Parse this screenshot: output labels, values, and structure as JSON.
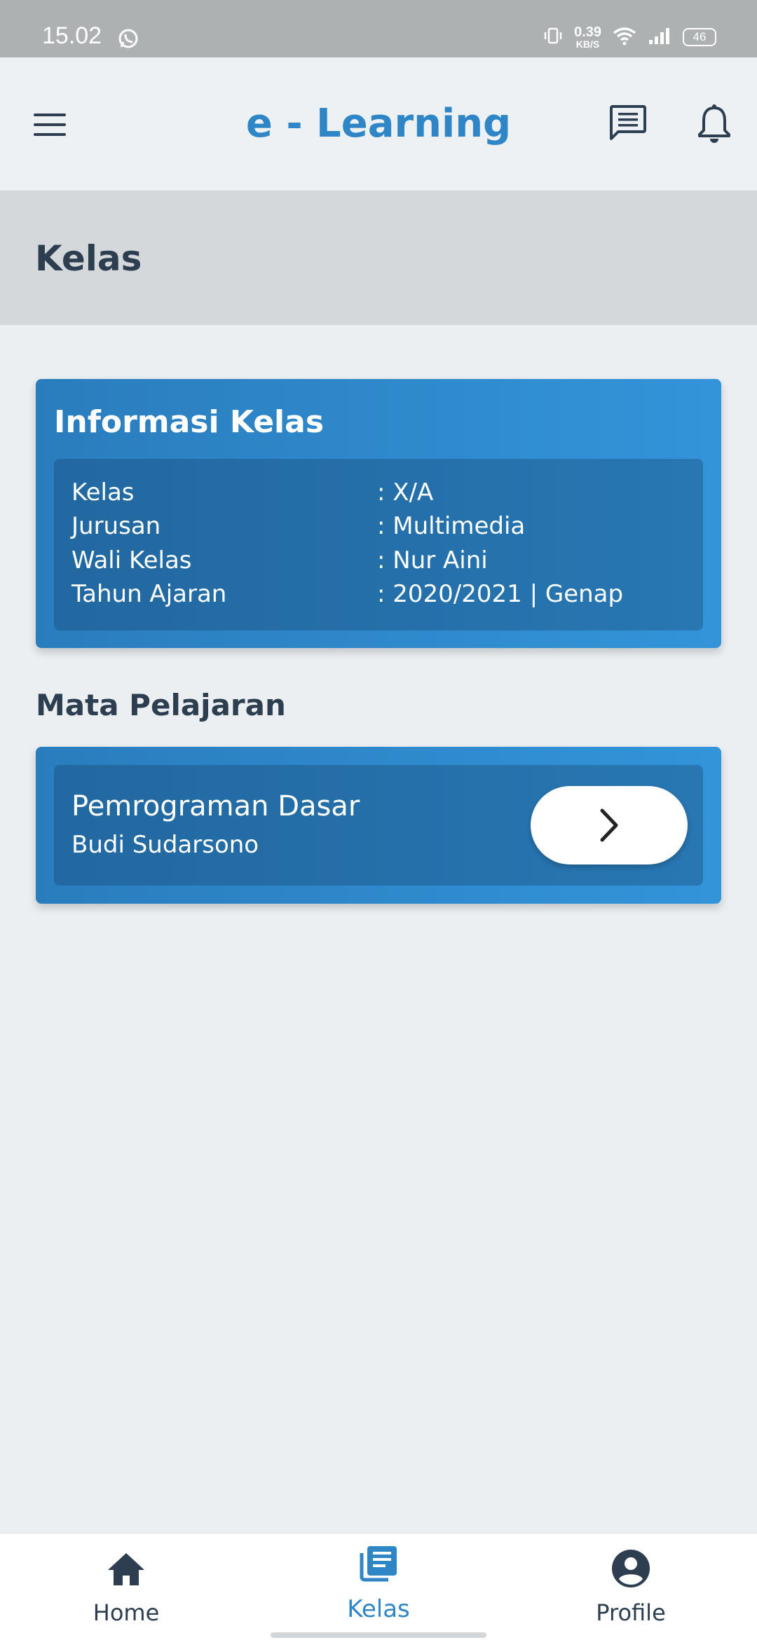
{
  "status_bar": {
    "time": "15.02",
    "net_speed_value": "0.39",
    "net_speed_unit": "KB/S",
    "battery": "46",
    "icons": [
      "whatsapp-icon",
      "vibrate-icon",
      "wifi-icon",
      "signal-icon",
      "battery-icon"
    ]
  },
  "topbar": {
    "title": "e - Learning",
    "icons": [
      "menu-icon",
      "chat-icon",
      "bell-icon"
    ],
    "accent_color": "#2f86c6"
  },
  "page": {
    "title": "Kelas"
  },
  "info_card": {
    "title": "Informasi Kelas",
    "rows": [
      {
        "label": "Kelas",
        "value": ": X/A"
      },
      {
        "label": "Jurusan",
        "value": ": Multimedia"
      },
      {
        "label": "Wali Kelas",
        "value": ": Nur Aini"
      },
      {
        "label": "Tahun Ajaran",
        "value": ": 2020/2021 | Genap"
      }
    ]
  },
  "subjects": {
    "section_title": "Mata Pelajaran",
    "items": [
      {
        "name": "Pemrograman Dasar",
        "teacher": "Budi Sudarsono"
      }
    ]
  },
  "bottom_nav": {
    "items": [
      {
        "label": "Home",
        "icon": "home-icon",
        "active": false
      },
      {
        "label": "Kelas",
        "icon": "book-icon",
        "active": true
      },
      {
        "label": "Profile",
        "icon": "account-circle-icon",
        "active": false
      }
    ]
  },
  "colors": {
    "card_gradient_start": "#2a7dbd",
    "card_gradient_end": "#3394d9",
    "text_dark": "#2c3e50"
  }
}
